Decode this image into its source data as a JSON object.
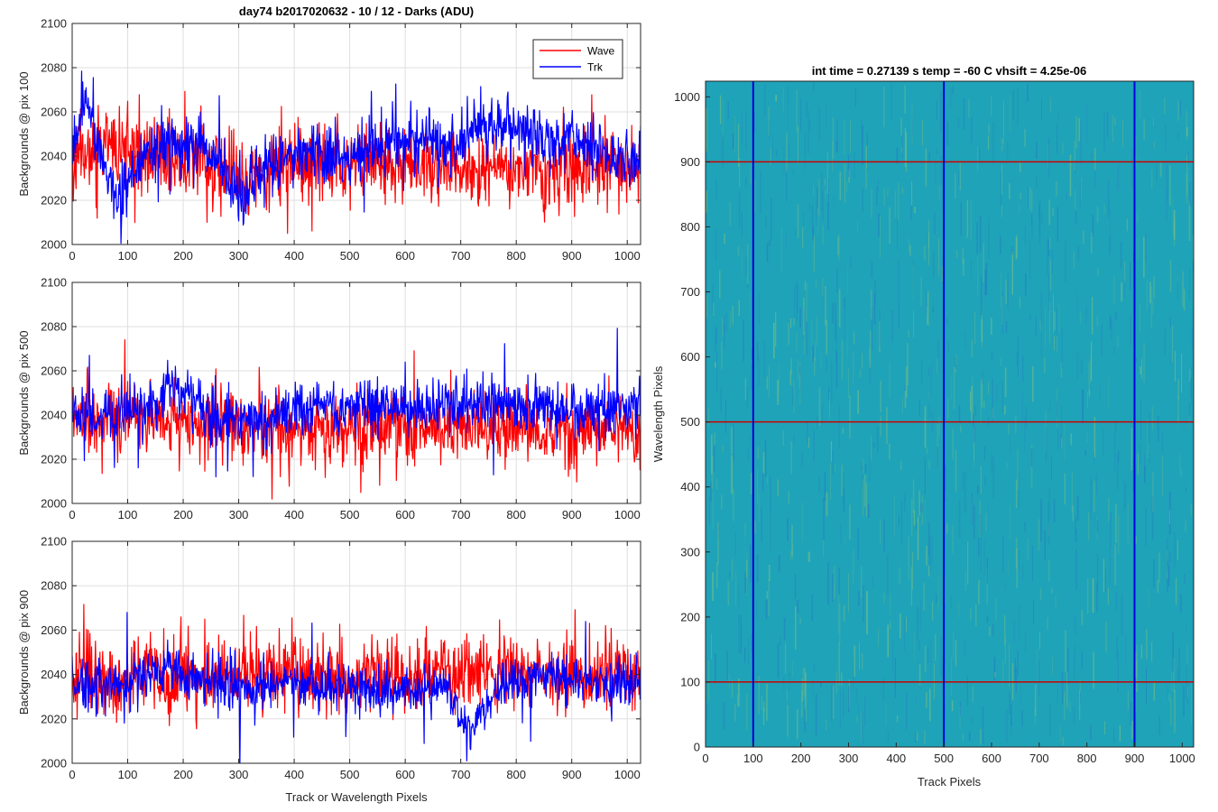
{
  "chart_data": [
    {
      "type": "line",
      "title": "day74 b2017020632 - 10 / 12 - Darks (ADU)",
      "xlabel": "",
      "ylabel": "Backgrounds @ pix 100",
      "xlim": [
        0,
        1024
      ],
      "ylim": [
        2000,
        2100
      ],
      "xticks": [
        0,
        100,
        200,
        300,
        400,
        500,
        600,
        700,
        800,
        900,
        1000
      ],
      "yticks": [
        2000,
        2020,
        2040,
        2060,
        2080,
        2100
      ],
      "grid": true,
      "legend": "top-right",
      "series": [
        {
          "name": "Wave",
          "color": "#ff0000",
          "seed": 11,
          "noise": 8.5,
          "x": [
            0,
            30,
            60,
            100,
            150,
            200,
            250,
            300,
            350,
            400,
            450,
            500,
            550,
            600,
            650,
            700,
            750,
            800,
            850,
            900,
            950,
            1024
          ],
          "y": [
            2038,
            2044,
            2044,
            2042,
            2040,
            2040,
            2036,
            2030,
            2033,
            2035,
            2037,
            2038,
            2037,
            2036,
            2035,
            2036,
            2036,
            2035,
            2032,
            2034,
            2036,
            2036
          ]
        },
        {
          "name": "Trk",
          "color": "#0000ff",
          "seed": 23,
          "noise": 6.5,
          "x": [
            0,
            15,
            25,
            35,
            50,
            60,
            80,
            100,
            130,
            160,
            200,
            250,
            280,
            300,
            320,
            350,
            400,
            450,
            500,
            550,
            600,
            650,
            700,
            730,
            750,
            800,
            850,
            900,
            950,
            1000,
            1024
          ],
          "y": [
            2040,
            2055,
            2062,
            2058,
            2045,
            2028,
            2022,
            2030,
            2040,
            2044,
            2044,
            2041,
            2030,
            2020,
            2025,
            2036,
            2040,
            2040,
            2038,
            2046,
            2048,
            2046,
            2046,
            2052,
            2055,
            2052,
            2048,
            2045,
            2042,
            2038,
            2036
          ]
        }
      ]
    },
    {
      "type": "line",
      "title": "",
      "xlabel": "",
      "ylabel": "Backgrounds @ pix 500",
      "xlim": [
        0,
        1024
      ],
      "ylim": [
        2000,
        2100
      ],
      "xticks": [
        0,
        100,
        200,
        300,
        400,
        500,
        600,
        700,
        800,
        900,
        1000
      ],
      "yticks": [
        2000,
        2020,
        2040,
        2060,
        2080,
        2100
      ],
      "grid": true,
      "series": [
        {
          "name": "Wave",
          "color": "#ff0000",
          "seed": 37,
          "noise": 8.0,
          "x": [
            0,
            100,
            200,
            300,
            400,
            500,
            600,
            700,
            800,
            900,
            1024
          ],
          "y": [
            2038,
            2040,
            2038,
            2036,
            2034,
            2033,
            2034,
            2035,
            2034,
            2033,
            2034
          ]
        },
        {
          "name": "Trk",
          "color": "#0000ff",
          "seed": 51,
          "noise": 6.0,
          "x": [
            0,
            100,
            150,
            180,
            210,
            250,
            300,
            350,
            400,
            450,
            500,
            600,
            700,
            800,
            900,
            1024
          ],
          "y": [
            2040,
            2040,
            2044,
            2052,
            2048,
            2040,
            2038,
            2038,
            2042,
            2046,
            2044,
            2044,
            2044,
            2044,
            2042,
            2044
          ]
        }
      ]
    },
    {
      "type": "line",
      "title": "",
      "xlabel": "Track or Wavelength Pixels",
      "ylabel": "Backgrounds @ pix 900",
      "xlim": [
        0,
        1024
      ],
      "ylim": [
        2000,
        2100
      ],
      "xticks": [
        0,
        100,
        200,
        300,
        400,
        500,
        600,
        700,
        800,
        900,
        1000
      ],
      "yticks": [
        2000,
        2020,
        2040,
        2060,
        2080,
        2100
      ],
      "grid": true,
      "series": [
        {
          "name": "Wave",
          "color": "#ff0000",
          "seed": 67,
          "noise": 8.0,
          "x": [
            0,
            100,
            200,
            300,
            400,
            500,
            600,
            700,
            800,
            900,
            1024
          ],
          "y": [
            2040,
            2040,
            2038,
            2040,
            2040,
            2040,
            2040,
            2040,
            2040,
            2040,
            2040
          ]
        },
        {
          "name": "Trk",
          "color": "#0000ff",
          "seed": 79,
          "noise": 5.5,
          "x": [
            0,
            100,
            170,
            200,
            300,
            400,
            500,
            600,
            680,
            700,
            715,
            730,
            760,
            800,
            850,
            900,
            1024
          ],
          "y": [
            2034,
            2036,
            2044,
            2040,
            2034,
            2036,
            2034,
            2034,
            2034,
            2022,
            2012,
            2018,
            2032,
            2040,
            2040,
            2038,
            2036
          ]
        }
      ]
    },
    {
      "type": "heatmap",
      "title": "int time = 0.27139 s   temp = -60 C   vhsift = 4.25e-06",
      "xlabel": "Track Pixels",
      "ylabel": "Wavelength Pixels",
      "xlim": [
        0,
        1024
      ],
      "ylim": [
        0,
        1024
      ],
      "xticks": [
        0,
        100,
        200,
        300,
        400,
        500,
        600,
        700,
        800,
        900,
        1000
      ],
      "yticks": [
        0,
        100,
        200,
        300,
        400,
        500,
        600,
        700,
        800,
        900,
        1000
      ],
      "colormap": "parula",
      "base_color": "#1fa3b8",
      "stripe_light": "#8cc77a",
      "stripe_dark": "#2277c4",
      "markers_horizontal": {
        "color": "#cc0000",
        "y": [
          100,
          500,
          900
        ]
      },
      "markers_vertical": {
        "color": "#0000dd",
        "x": [
          100,
          500,
          900
        ]
      }
    }
  ]
}
